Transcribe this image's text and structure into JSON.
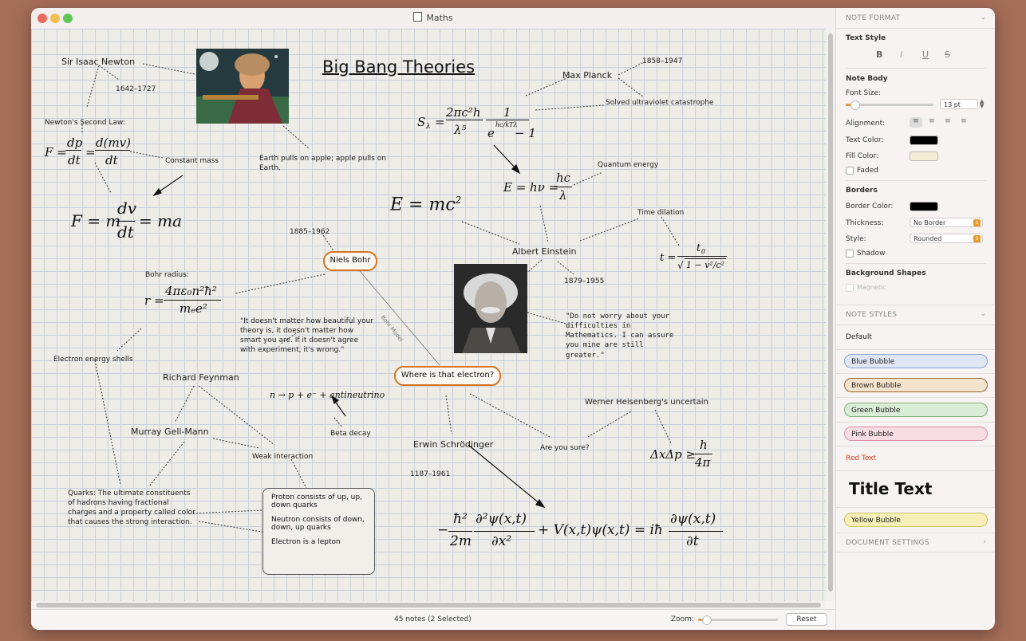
{
  "window": {
    "title": "Maths"
  },
  "canvas": {
    "title": "Big Bang Theories",
    "notes": {
      "newton": "Sir Isaac Newton",
      "newton_years": "1642–1727",
      "second_law": "Newton's Second Law:",
      "constant_mass": "Constant mass",
      "apple": "Earth pulls on apple; apple pulls on Earth.",
      "planck": "Max Planck",
      "planck_years": "1858–1947",
      "uv_catastrophe": "Solved ultraviolet catastrophe",
      "quantum_energy": "Quantum energy",
      "einstein": "Albert Einstein",
      "einstein_years": "1879–1955",
      "time_dilation": "Time dilation",
      "bohr_years": "1885–1962",
      "bohr_radius": "Bohr radius:",
      "einstein_quote": "\"Do not worry about your difficulties in Mathematics. I can assure you mine are still greater.\"",
      "feynman_quote": "\"It doesn't matter how beautiful your theory is, it doesn't matter how smart you are. If it doesn't agree with experiment, it's wrong.\"",
      "electron_shells": "Electron energy shells",
      "feynman": "Richard Feynman",
      "gell_mann": "Murray Gell-Mann",
      "weak_interaction": "Weak interaction",
      "beta_decay": "Beta decay",
      "quarks": "Quarks: The ultimate constituents of hadrons having fractional charges and a property called color that causes the strong interaction.",
      "schrodinger": "Erwin Schrödinger",
      "schrodinger_years": "1187–1961",
      "are_you_sure": "Are you sure?",
      "heisenberg": "Werner Heisenberg's uncertain",
      "bohr_model": "Bohr Model"
    },
    "bubbles": {
      "bohr": "Niels Bohr",
      "electron": "Where is that electron?"
    },
    "quark_box": {
      "proton": "Proton consists of up, up, down quarks",
      "neutron": "Neutron consists of down, down, up quarks",
      "electron": "Electron is a lepton"
    },
    "equations": {
      "newton_f": "F =",
      "dp": "dp",
      "dt1": "dt",
      "eq": "=",
      "dmv": "d(mv)",
      "dt2": "dt",
      "f_m": "F = m",
      "dv": "dv",
      "dt3": "dt",
      "ma": "= ma",
      "planck_s": "S",
      "planck_lambda_sub": "λ",
      "planck_eq": "=",
      "planck_num": "2πc²h",
      "planck_den": "λ⁵",
      "one": "1",
      "exp_den": "e",
      "exp_pow": "hc/kTλ",
      "minus1": "− 1",
      "emc2": "E = mc",
      "emc2_pow": "2",
      "ehv": "E = hν =",
      "hc": "hc",
      "lambda": "λ",
      "t_eq": "t =",
      "t0": "t",
      "t0_sub": "0",
      "root": "1 − v²/c²",
      "bohr_r": "r =",
      "bohr_num": "4πε₀n²ħ²",
      "bohr_den": "mₑe²",
      "beta": "n → p + e⁻ + antineutrino",
      "heis": "ΔxΔp ≥",
      "h": "h",
      "four_pi": "4π",
      "schro_minus": "−",
      "hbar2": "ħ²",
      "two_m": "2m",
      "d2psi": "∂²ψ(x,t)",
      "dx2": "∂x²",
      "v_term": "+ V(x,t)ψ(x,t) = iħ",
      "dpsi": "∂ψ(x,t)",
      "dt4": "∂t"
    }
  },
  "status": {
    "notes_count": "45 notes (2 Selected)",
    "zoom_label": "Zoom:",
    "zoom_value": 0.1,
    "reset": "Reset"
  },
  "sidebar": {
    "note_format": "NOTE FORMAT",
    "text_style": "Text Style",
    "bold": "B",
    "italic": "I",
    "underline": "U",
    "strike": "S",
    "note_body": "Note Body",
    "font_size_label": "Font Size:",
    "font_size_value": "13 pt",
    "font_size_slider": 0.1,
    "alignment_label": "Alignment:",
    "text_color_label": "Text Color:",
    "text_color": "#000000",
    "fill_color_label": "Fill Color:",
    "fill_color": "#f5ecd6",
    "faded": "Faded",
    "borders": "Borders",
    "border_color_label": "Border Color:",
    "border_color": "#000000",
    "thickness_label": "Thickness:",
    "thickness_value": "No Border",
    "style_label": "Style:",
    "style_value": "Rounded",
    "shadow": "Shadow",
    "background_shapes": "Background Shapes",
    "magnetic": "Magnetic",
    "note_styles": "NOTE STYLES",
    "styles": {
      "default": "Default",
      "blue": "Blue Bubble",
      "brown": "Brown Bubble",
      "green": "Green Bubble",
      "pink": "Pink Bubble",
      "red": "Red Text",
      "title": "Title Text",
      "yellow": "Yellow Bubble"
    },
    "document_settings": "DOCUMENT SETTINGS"
  }
}
